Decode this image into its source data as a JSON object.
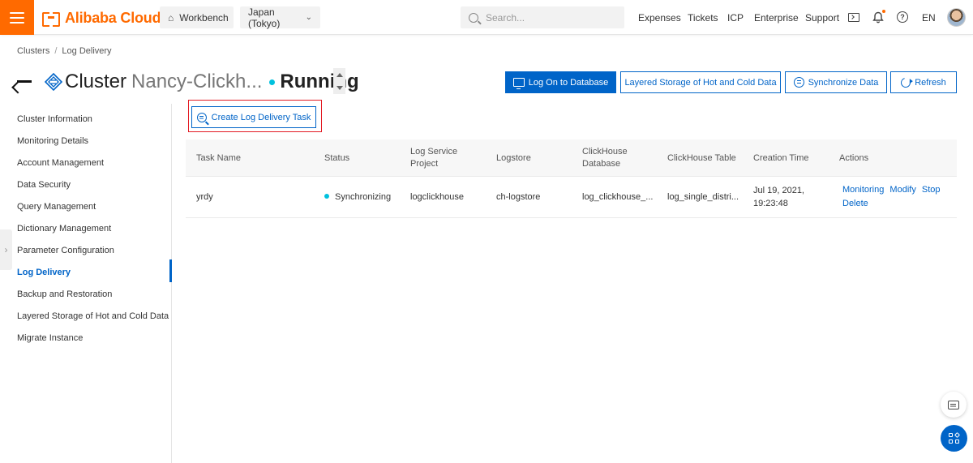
{
  "topbar": {
    "brand": "Alibaba Cloud",
    "workbench": "Workbench",
    "region": "Japan (Tokyo)",
    "search_placeholder": "Search...",
    "links": [
      "Expenses",
      "Tickets",
      "ICP",
      "Enterprise",
      "Support"
    ],
    "language": "EN",
    "accent_color": "#ff6a00"
  },
  "breadcrumb": {
    "root": "Clusters",
    "separator": "/",
    "current": "Log Delivery"
  },
  "header": {
    "title": "Cluster",
    "cluster_name": "Nancy-Clickh...",
    "status": "Running",
    "buttons": {
      "logon": "Log On to Database",
      "layered": "Layered Storage of Hot and Cold Data",
      "sync": "Synchronize Data",
      "refresh": "Refresh"
    }
  },
  "sidebar": {
    "items": [
      "Cluster Information",
      "Monitoring Details",
      "Account Management",
      "Data Security",
      "Query Management",
      "Dictionary Management",
      "Parameter Configuration",
      "Log Delivery",
      "Backup and Restoration",
      "Layered Storage of Hot and Cold Data",
      "Migrate Instance"
    ],
    "active": "Log Delivery"
  },
  "create_button": "Create Log Delivery Task",
  "table": {
    "headers": {
      "task_name": "Task Name",
      "status": "Status",
      "project_line1": "Log Service",
      "project_line2": "Project",
      "logstore": "Logstore",
      "db_line1": "ClickHouse",
      "db_line2": "Database",
      "table": "ClickHouse Table",
      "created": "Creation Time",
      "actions": "Actions"
    },
    "rows": [
      {
        "task_name": "yrdy",
        "status": "Synchronizing",
        "project": "logclickhouse",
        "logstore": "ch-logstore",
        "database": "log_clickhouse_...",
        "table": "log_single_distri...",
        "created_line1": "Jul 19, 2021,",
        "created_line2": "19:23:48",
        "actions": [
          "Monitoring",
          "Modify",
          "Stop",
          "Delete"
        ]
      }
    ]
  },
  "colors": {
    "primary": "#0064c8",
    "status_running": "#00c1de",
    "highlight": "#e31b23"
  }
}
